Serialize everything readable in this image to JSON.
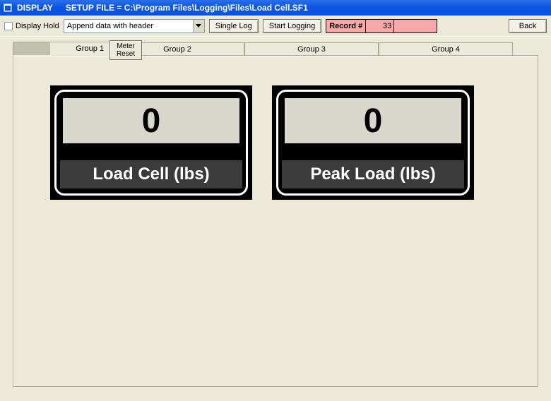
{
  "titlebar": {
    "app": "DISPLAY",
    "setup_label": "SETUP FILE = C:\\Program Files\\Logging\\Files\\Load Cell.SF1"
  },
  "toolbar": {
    "display_hold_label": "Display Hold",
    "append_mode": "Append data with header",
    "single_log_label": "Single Log",
    "start_logging_label": "Start Logging",
    "record_label": "Record #",
    "record_value": "33",
    "back_label": "Back"
  },
  "tabs": {
    "group1": "Group 1",
    "group2": "Group 2",
    "group3": "Group 3",
    "group4": "Group 4",
    "meter_reset": "Meter\nReset"
  },
  "gauges": [
    {
      "value": "0",
      "label": "Load Cell (lbs)"
    },
    {
      "value": "0",
      "label": "Peak Load (lbs)"
    }
  ]
}
